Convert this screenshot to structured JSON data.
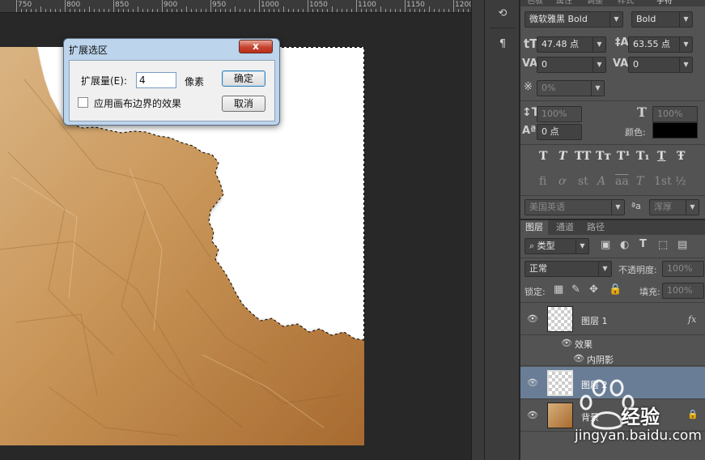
{
  "ruler": {
    "marks": [
      "750",
      "800",
      "850",
      "900",
      "950",
      "1000",
      "1050",
      "1100",
      "1150",
      "1200"
    ]
  },
  "dialog": {
    "title": "扩展选区",
    "close_label": "x",
    "amount_label": "扩展量(E):",
    "amount_value": "4",
    "unit_label": "像素",
    "checkbox_label": "应用画布边界的效果",
    "ok_label": "确定",
    "cancel_label": "取消"
  },
  "character_panel": {
    "top_tabs": [
      "色板",
      "属性",
      "调整",
      "样式",
      "字符"
    ],
    "font_family": "微软雅黑 Bold",
    "font_style": "Bold",
    "font_size": "47.48 点",
    "leading": "63.55 点",
    "kerning": "0",
    "tracking": "0",
    "tsume": "0%",
    "vertical_scale": "100%",
    "horizontal_scale": "100%",
    "baseline_shift": "0 点",
    "color_label": "颜色:",
    "color_value": "#000000",
    "style_glyphs": [
      "T",
      "T",
      "TT",
      "Tт",
      "T¹",
      "T₁",
      "T",
      "Ŧ"
    ],
    "opentype_glyphs": [
      "fi",
      "ơ",
      "st",
      "A",
      "aa",
      "T",
      "1st",
      "½"
    ],
    "language": "美国英语",
    "aa_label": "ªa",
    "antialias": "浑厚"
  },
  "layers_panel": {
    "tabs": [
      "图层",
      "通道",
      "路径"
    ],
    "filter_kind": "类型",
    "blend_mode": "正常",
    "opacity_label": "不透明度:",
    "opacity_value": "100%",
    "lock_label": "锁定:",
    "fill_label": "填充:",
    "fill_value": "100%",
    "layers": [
      {
        "name": "图层 1",
        "fx": "fx",
        "selected": false
      },
      {
        "name": "图层 2",
        "selected": true
      },
      {
        "name": "背景",
        "locked": true
      }
    ],
    "effects_label": "效果",
    "inner_shadow_label": "内阴影"
  },
  "watermark": {
    "brand": "经验",
    "url": "jingyan.baidu.com"
  }
}
